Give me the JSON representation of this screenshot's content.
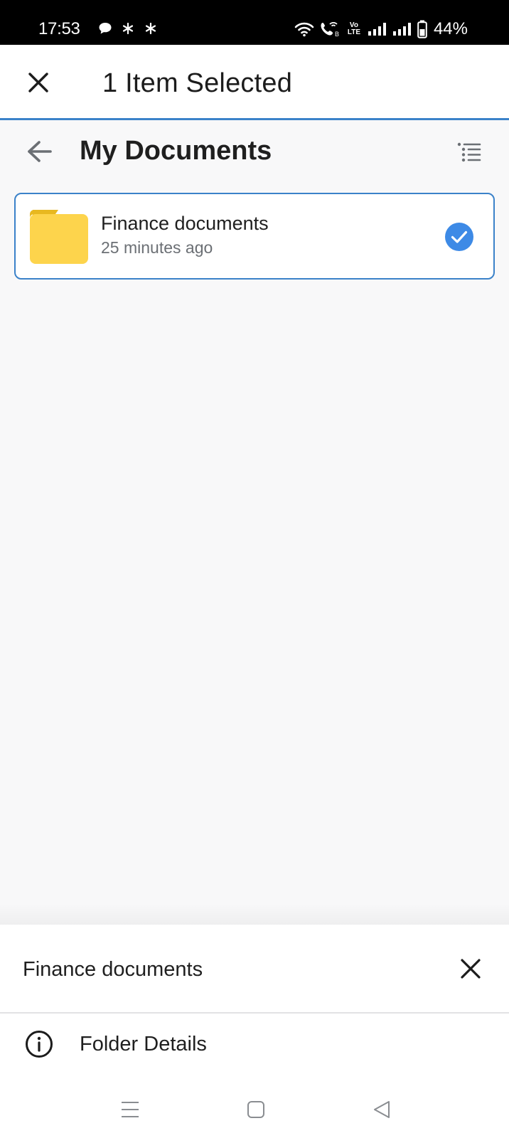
{
  "status_bar": {
    "time": "17:53",
    "battery": "44%",
    "volte_line1": "Vo",
    "volte_line2": "LTE"
  },
  "header": {
    "title": "1 Item Selected"
  },
  "folder": {
    "title": "My Documents"
  },
  "items": [
    {
      "name": "Finance documents",
      "modified": "25 minutes ago",
      "selected": true
    }
  ],
  "bottom_sheet": {
    "title": "Finance documents",
    "options": [
      {
        "label": "Folder Details",
        "icon": "info-icon"
      }
    ]
  },
  "colors": {
    "accent": "#3b82c9",
    "check": "#3d8ae6",
    "folder": "#fdd44c",
    "folder_tab": "#e8b820"
  }
}
